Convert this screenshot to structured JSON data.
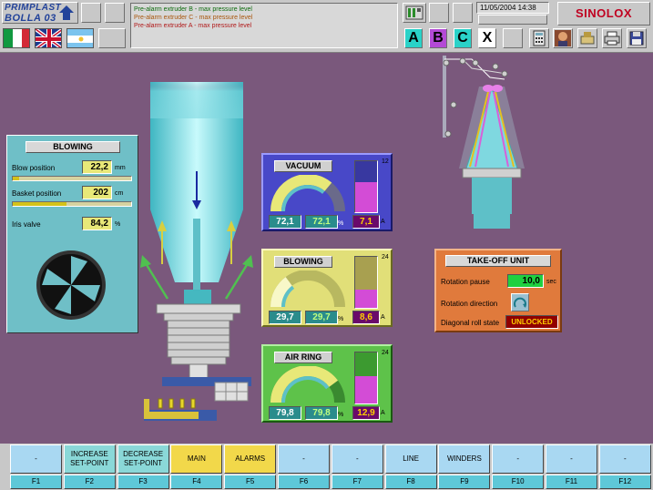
{
  "header": {
    "logo_line1": "PRIMPLAST",
    "logo_line2": "BOLLA 03",
    "alarms": [
      "Pre-alarm extruder B - max pressure level",
      "Pre-alarm extruder C - max pressure level",
      "Pre-alarm extruder A - max pressure level"
    ],
    "alarm_colors": [
      "#0d6b0d",
      "#a8560c",
      "#b01818"
    ],
    "datetime": "11/05/2004 14:38",
    "brand": "SINOLOX",
    "brand_color": "#c00020",
    "extruder_buttons": [
      "A",
      "B",
      "C",
      "X"
    ],
    "extruder_colors": [
      "#2ad2c8",
      "#b44ad6",
      "#2ad2c8",
      "#ffffff"
    ],
    "flags": [
      "italy-flag-icon",
      "uk-flag-icon",
      "argentina-flag-icon"
    ],
    "tool_icons": [
      "calculator-icon",
      "operator-photo-icon",
      "settings-machine-icon",
      "printer-icon",
      "save-disk-icon"
    ]
  },
  "blowing_panel": {
    "title": "BLOWING",
    "blow_position_label": "Blow position",
    "blow_position_value": "22,2",
    "blow_position_unit": "mm",
    "blow_position_fraction": 0.05,
    "basket_position_label": "Basket position",
    "basket_position_value": "202",
    "basket_position_unit": "cm",
    "basket_position_fraction": 0.45,
    "iris_label": "Iris valve",
    "iris_value": "84,2",
    "iris_unit": "%"
  },
  "vacuum": {
    "title": "VACUUM",
    "setpoint": "72,1",
    "actual": "72,1",
    "pct_unit": "%",
    "current": "7,1",
    "current_unit": "A",
    "max": "12",
    "tank_fraction": 0.59,
    "color": "#4848c8"
  },
  "blowing_gauge": {
    "title": "BLOWING",
    "setpoint": "29,7",
    "actual": "29,7",
    "pct_unit": "%",
    "current": "8,6",
    "current_unit": "A",
    "max": "24",
    "tank_fraction": 0.36,
    "color": "#e1df78"
  },
  "air_ring": {
    "title": "AIR RING",
    "setpoint": "79,8",
    "actual": "79,8",
    "pct_unit": "%",
    "current": "12,9",
    "current_unit": "A",
    "max": "24",
    "tank_fraction": 0.54,
    "color": "#5ec24a"
  },
  "takeoff": {
    "title": "TAKE-OFF UNIT",
    "rotation_pause_label": "Rotation pause",
    "rotation_pause_value": "10,0",
    "rotation_pause_unit": "sec",
    "rotation_direction_label": "Rotation direction",
    "diagonal_label": "Diagonal roll state",
    "diagonal_value": "UNLOCKED"
  },
  "fkeys": [
    {
      "label": "-",
      "key": "F1",
      "color": "#a9d8f2"
    },
    {
      "label": "INCREASE SET-POINT",
      "key": "F2",
      "color": "#8ad8d8"
    },
    {
      "label": "DECREASE SET-POINT",
      "key": "F3",
      "color": "#8ad8d8"
    },
    {
      "label": "MAIN",
      "key": "F4",
      "color": "#f2d84a"
    },
    {
      "label": "ALARMS",
      "key": "F5",
      "color": "#f2d84a"
    },
    {
      "label": "-",
      "key": "F6",
      "color": "#a9d8f2"
    },
    {
      "label": "-",
      "key": "F7",
      "color": "#a9d8f2"
    },
    {
      "label": "LINE",
      "key": "F8",
      "color": "#a9d8f2"
    },
    {
      "label": "WINDERS",
      "key": "F9",
      "color": "#a9d8f2"
    },
    {
      "label": "-",
      "key": "F10",
      "color": "#a9d8f2"
    },
    {
      "label": "-",
      "key": "F11",
      "color": "#a9d8f2"
    },
    {
      "label": "-",
      "key": "F12",
      "color": "#a9d8f2"
    }
  ]
}
